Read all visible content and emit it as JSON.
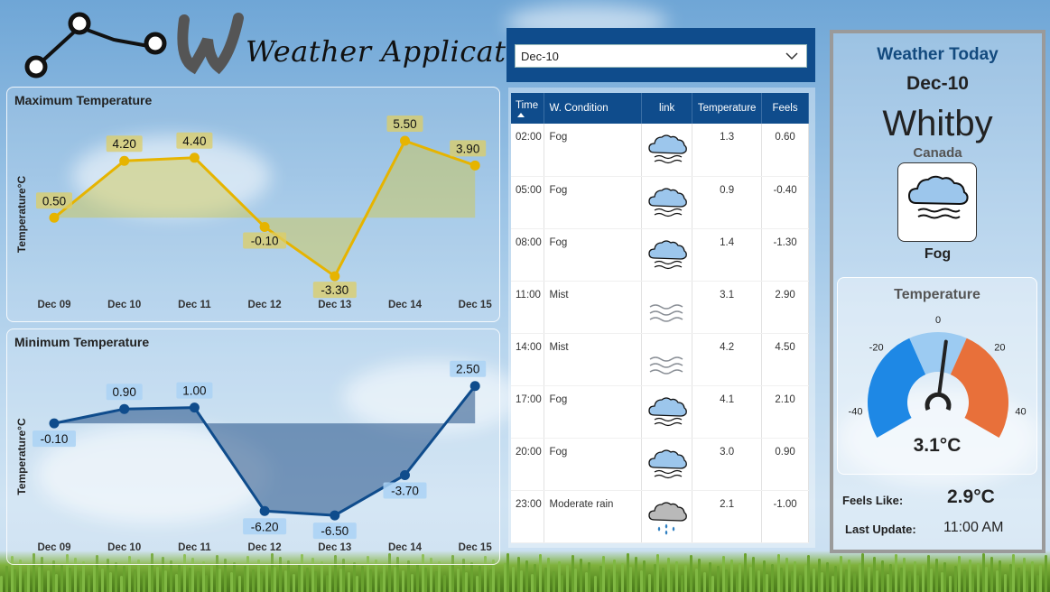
{
  "app": {
    "title": "Weather Application"
  },
  "date_select": {
    "value": "Dec-10"
  },
  "max_chart": {
    "title": "Maximum Temperature",
    "ylabel": "Temperature°C",
    "color": "#e6b400",
    "fill": "rgba(210,200,70,0.45)",
    "label_bg": "rgba(222,205,100,0.75)"
  },
  "min_chart": {
    "title": "Minimum Temperature",
    "ylabel": "Temperature°C",
    "color": "#0f4c8c",
    "fill": "rgba(35,80,135,0.55)",
    "label_bg": "rgba(170,210,245,0.85)"
  },
  "chart_data": [
    {
      "type": "area",
      "title": "Maximum Temperature",
      "ylabel": "Temperature°C",
      "categories": [
        "Dec 09",
        "Dec 10",
        "Dec 11",
        "Dec 12",
        "Dec 13",
        "Dec 14",
        "Dec 15"
      ],
      "values": [
        0.5,
        4.2,
        4.4,
        -0.1,
        -3.3,
        5.5,
        3.9
      ],
      "labels": [
        "0.50",
        "4.20",
        "4.40",
        "-0.10",
        "-3.30",
        "5.50",
        "3.90"
      ],
      "ylim": [
        -4,
        6.5
      ]
    },
    {
      "type": "area",
      "title": "Minimum Temperature",
      "ylabel": "Temperature°C",
      "categories": [
        "Dec 09",
        "Dec 10",
        "Dec 11",
        "Dec 12",
        "Dec 13",
        "Dec 14",
        "Dec 15"
      ],
      "values": [
        -0.1,
        0.9,
        1.0,
        -6.2,
        -6.5,
        -3.7,
        2.5
      ],
      "labels": [
        "-0.10",
        "0.90",
        "1.00",
        "-6.20",
        "-6.50",
        "-3.70",
        "2.50"
      ],
      "ylim": [
        -7.5,
        3.8
      ]
    }
  ],
  "table": {
    "headers": {
      "time": "Time",
      "condition": "W. Condition",
      "link": "link",
      "temperature": "Temperature",
      "feels": "Feels"
    },
    "rows": [
      {
        "time": "02:00",
        "condition": "Fog",
        "icon": "fog-icon",
        "temperature": "1.3",
        "feels": "0.60"
      },
      {
        "time": "05:00",
        "condition": "Fog",
        "icon": "fog-icon",
        "temperature": "0.9",
        "feels": "-0.40"
      },
      {
        "time": "08:00",
        "condition": "Fog",
        "icon": "fog-icon",
        "temperature": "1.4",
        "feels": "-1.30"
      },
      {
        "time": "11:00",
        "condition": "Mist",
        "icon": "mist-icon",
        "temperature": "3.1",
        "feels": "2.90"
      },
      {
        "time": "14:00",
        "condition": "Mist",
        "icon": "mist-icon",
        "temperature": "4.2",
        "feels": "4.50"
      },
      {
        "time": "17:00",
        "condition": "Fog",
        "icon": "fog-icon",
        "temperature": "4.1",
        "feels": "2.10"
      },
      {
        "time": "20:00",
        "condition": "Fog",
        "icon": "fog-icon",
        "temperature": "3.0",
        "feels": "0.90"
      },
      {
        "time": "23:00",
        "condition": "Moderate rain",
        "icon": "rain-icon",
        "temperature": "2.1",
        "feels": "-1.00"
      }
    ]
  },
  "today": {
    "title": "Weather Today",
    "date": "Dec-10",
    "city": "Whitby",
    "country": "Canada",
    "condition": "Fog",
    "icon": "fog-icon"
  },
  "gauge": {
    "title": "Temperature",
    "value_text": "3.1°C",
    "value": 3.1,
    "min": -50,
    "max": 50,
    "tick_labels": [
      "-40",
      "-20",
      "0",
      "20",
      "40"
    ],
    "colors": {
      "cold": "#1e88e5",
      "mild": "#9ccbf2",
      "warm": "#e8703a",
      "needle": "#222222"
    }
  },
  "footer": {
    "feels_label": "Feels Like:",
    "feels_value": "2.9°C",
    "update_label": "Last Update:",
    "update_value": "11:00 AM"
  }
}
